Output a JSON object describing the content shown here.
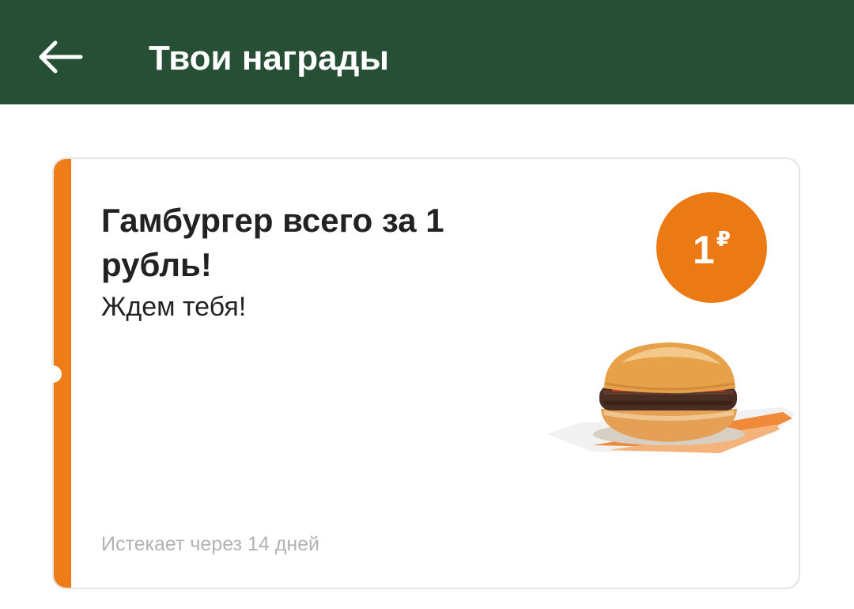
{
  "header": {
    "title": "Твои награды",
    "back_icon": "arrow-left-icon",
    "background_color": "#264f36"
  },
  "reward": {
    "title": "Гамбургер всего за 1 рубль!",
    "subtitle": "Ждем тебя!",
    "expiry": "Истекает через 14 дней",
    "price_value": "1",
    "price_currency": "₽",
    "accent_color": "#ee7d18",
    "image": "hamburger-image"
  }
}
